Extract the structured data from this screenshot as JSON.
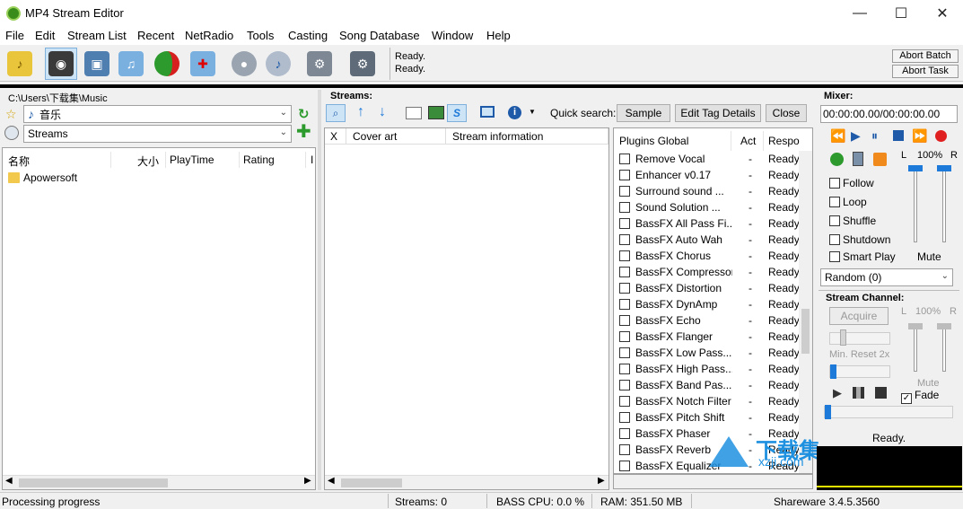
{
  "app": {
    "title": "MP4 Stream Editor"
  },
  "window_controls": {
    "minimize": "—",
    "maximize": "☐",
    "close": "✕"
  },
  "menu": [
    "File",
    "Edit",
    "Stream List",
    "Recent",
    "NetRadio",
    "Tools",
    "Casting",
    "Song Database",
    "Window",
    "Help"
  ],
  "toolbar": {
    "status_lines": [
      "Ready.",
      "Ready."
    ],
    "abort_batch": "Abort Batch",
    "abort_task": "Abort Task"
  },
  "left_panel": {
    "path": "C:\\Users\\下载集\\Music",
    "folder_select": "音乐",
    "stream_select": "Streams",
    "columns": [
      "名称",
      "大小",
      "PlayTime",
      "Rating",
      "I"
    ],
    "items": [
      {
        "name": "Apowersoft"
      }
    ]
  },
  "streams_panel": {
    "heading": "Streams:",
    "quick_search_label": "Quick search:",
    "sample_button": "Sample",
    "edit_tag_button": "Edit Tag Details",
    "close_button": "Close",
    "columns": [
      "X",
      "Cover art",
      "Stream information"
    ]
  },
  "plugins": {
    "columns": [
      "Plugins Global",
      "Act",
      "Respo"
    ],
    "rows": [
      {
        "name": "Remove Vocal",
        "act": "-",
        "resp": "Ready"
      },
      {
        "name": "Enhancer v0.17",
        "act": "-",
        "resp": "Ready"
      },
      {
        "name": "Surround sound ...",
        "act": "-",
        "resp": "Ready"
      },
      {
        "name": "Sound Solution ...",
        "act": "-",
        "resp": "Ready"
      },
      {
        "name": "BassFX All Pass Fi...",
        "act": "-",
        "resp": "Ready"
      },
      {
        "name": "BassFX Auto Wah",
        "act": "-",
        "resp": "Ready"
      },
      {
        "name": "BassFX Chorus",
        "act": "-",
        "resp": "Ready"
      },
      {
        "name": "BassFX Compressor",
        "act": "-",
        "resp": "Ready"
      },
      {
        "name": "BassFX Distortion",
        "act": "-",
        "resp": "Ready"
      },
      {
        "name": "BassFX DynAmp",
        "act": "-",
        "resp": "Ready"
      },
      {
        "name": "BassFX Echo",
        "act": "-",
        "resp": "Ready"
      },
      {
        "name": "BassFX Flanger",
        "act": "-",
        "resp": "Ready"
      },
      {
        "name": "BassFX Low Pass...",
        "act": "-",
        "resp": "Ready"
      },
      {
        "name": "BassFX High Pass...",
        "act": "-",
        "resp": "Ready"
      },
      {
        "name": "BassFX Band Pas...",
        "act": "-",
        "resp": "Ready"
      },
      {
        "name": "BassFX Notch Filter",
        "act": "-",
        "resp": "Ready"
      },
      {
        "name": "BassFX Pitch Shift",
        "act": "-",
        "resp": "Ready"
      },
      {
        "name": "BassFX Phaser",
        "act": "-",
        "resp": "Ready"
      },
      {
        "name": "BassFX Reverb",
        "act": "-",
        "resp": "Ready"
      },
      {
        "name": "BassFX Equalizer",
        "act": "-",
        "resp": "Ready"
      }
    ]
  },
  "mixer": {
    "heading": "Mixer:",
    "time": "00:00:00.00/00:00:00.00",
    "volume_label_l": "L",
    "volume_pct": "100%",
    "volume_label_r": "R",
    "options": [
      "Follow",
      "Loop",
      "Shuffle",
      "Shutdown",
      "Smart Play"
    ],
    "mute": "Mute",
    "random_select": "Random (0)",
    "stream_channel_heading": "Stream Channel:",
    "acquire": "Acquire",
    "ch_label_l": "L",
    "ch_pct": "100%",
    "ch_label_r": "R",
    "min_reset": "Min. Reset 2x",
    "ch_mute": "Mute",
    "fade": "Fade",
    "status": "Ready."
  },
  "statusbar": {
    "progress": "Processing progress",
    "streams": "Streams: 0",
    "cpu": "BASS CPU: 0.0 %",
    "ram": "RAM: 351.50 MB",
    "version": "Shareware 3.4.5.3560"
  },
  "watermark": {
    "text": "下载集",
    "sub": "xzji.com"
  },
  "colors": {
    "accent": "#1e7ad8",
    "active_tool": "#cde4f7"
  }
}
